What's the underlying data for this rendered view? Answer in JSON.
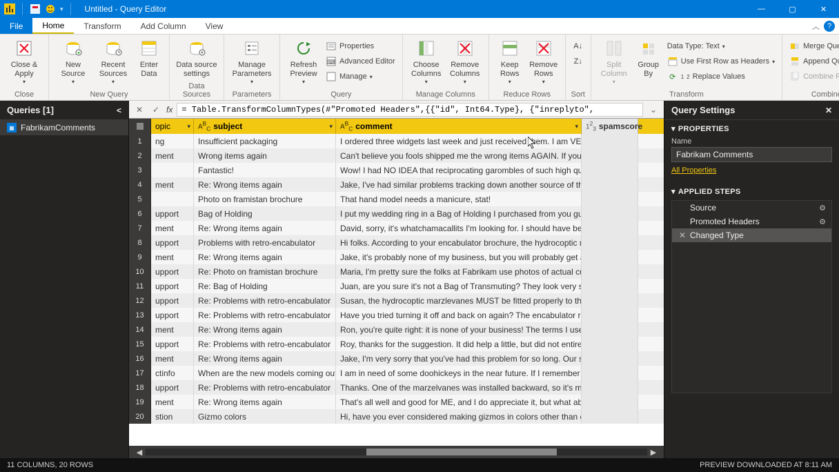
{
  "window": {
    "title": "Untitled - Query Editor"
  },
  "tabs": {
    "file": "File",
    "home": "Home",
    "transform": "Transform",
    "add_column": "Add Column",
    "view": "View"
  },
  "ribbon": {
    "close_apply": "Close &\nApply",
    "close_group": "Close",
    "new_source": "New\nSource",
    "recent_sources": "Recent\nSources",
    "enter_data": "Enter\nData",
    "new_query_group": "New Query",
    "data_source_settings": "Data source\nsettings",
    "data_sources_group": "Data Sources",
    "manage_parameters": "Manage\nParameters",
    "parameters_group": "Parameters",
    "refresh_preview": "Refresh\nPreview",
    "properties": "Properties",
    "advanced_editor": "Advanced Editor",
    "manage": "Manage",
    "query_group": "Query",
    "choose_columns": "Choose\nColumns",
    "remove_columns": "Remove\nColumns",
    "manage_columns_group": "Manage Columns",
    "keep_rows": "Keep\nRows",
    "remove_rows": "Remove\nRows",
    "reduce_rows_group": "Reduce Rows",
    "sort_group": "Sort",
    "split_column": "Split\nColumn",
    "group_by": "Group\nBy",
    "data_type": "Data Type: Text",
    "first_row_headers": "Use First Row as Headers",
    "replace_values": "Replace Values",
    "transform_group": "Transform",
    "merge_queries": "Merge Queries",
    "append_queries": "Append Queries",
    "combine_files": "Combine Files",
    "combine_group": "Combine"
  },
  "queries": {
    "header": "Queries [1]",
    "items": [
      {
        "name": "FabrikamComments"
      }
    ]
  },
  "formula": "= Table.TransformColumnTypes(#\"Promoted Headers\",{{\"id\", Int64.Type}, {\"inreplyto\",",
  "columns": {
    "topic": "opic",
    "subject": "subject",
    "comment": "comment",
    "spamscore": "spamscore"
  },
  "rows": [
    {
      "n": 1,
      "topic": "ng",
      "subject": "Insufficient packaging",
      "comment": "I ordered three widgets last week and just received them. I am VERY di..."
    },
    {
      "n": 2,
      "topic": "ment",
      "subject": "Wrong items again",
      "comment": "Can't believe you fools shipped me the wrong items AGAIN. If you wer..."
    },
    {
      "n": 3,
      "topic": "",
      "subject": "Fantastic!",
      "comment": "Wow! I had NO IDEA that reciprocating garombles of such high quality ..."
    },
    {
      "n": 4,
      "topic": "ment",
      "subject": "Re: Wrong items again",
      "comment": "Jake, I've had similar problems tracking down another source of thinga..."
    },
    {
      "n": 5,
      "topic": "",
      "subject": "Photo on framistan brochure",
      "comment": "That hand model needs a manicure, stat!"
    },
    {
      "n": 6,
      "topic": "upport",
      "subject": "Bag of Holding",
      "comment": "I put my wedding ring in a Bag of Holding I purchased from you guys (f..."
    },
    {
      "n": 7,
      "topic": "ment",
      "subject": "Re: Wrong items again",
      "comment": "David, sorry, it's whatchamacallits I'm looking for. I should have been ..."
    },
    {
      "n": 8,
      "topic": "upport",
      "subject": "Problems with retro-encabulator",
      "comment": "Hi folks. According to your encabulator brochure, the hydrocoptic mar..."
    },
    {
      "n": 9,
      "topic": "ment",
      "subject": "Re: Wrong items again",
      "comment": "Jake, it's probably none of my business, but you will probably get a bet..."
    },
    {
      "n": 10,
      "topic": "upport",
      "subject": "Re: Photo on framistan brochure",
      "comment": "Maria, I'm pretty sure the folks at Fabrikam use photos of actual custo..."
    },
    {
      "n": 11,
      "topic": "upport",
      "subject": "Re: Bag of Holding",
      "comment": "Juan, are you sure it's not a Bag of Transmuting? They look very simila..."
    },
    {
      "n": 12,
      "topic": "upport",
      "subject": "Re: Problems with retro-encabulator",
      "comment": "Susan, the hydrocoptic marzlevanes MUST be fitted properly to the a..."
    },
    {
      "n": 13,
      "topic": "upport",
      "subject": "Re: Problems with retro-encabulator",
      "comment": "Have you tried turning it off and back on again? The encabulator runs ..."
    },
    {
      "n": 14,
      "topic": "ment",
      "subject": "Re: Wrong items again",
      "comment": "Ron, you're quite right: it is none of your business! The terms I used ar..."
    },
    {
      "n": 15,
      "topic": "upport",
      "subject": "Re: Problems with retro-encabulator",
      "comment": "Roy, thanks for the suggestion. It did help a little, but did not entirely e..."
    },
    {
      "n": 16,
      "topic": "ment",
      "subject": "Re: Wrong items again",
      "comment": "Jake, I'm very sorry that you've had this problem for so long. Our syste..."
    },
    {
      "n": 17,
      "topic": "ctinfo",
      "subject": "When are the new models coming out?",
      "comment": "I am in need of some doohickeys in the near future. If I remember corr..."
    },
    {
      "n": 18,
      "topic": "upport",
      "subject": "Re: Problems with retro-encabulator",
      "comment": "Thanks. One of the marzelvanes was installed backward, so it's my faul..."
    },
    {
      "n": 19,
      "topic": "ment",
      "subject": "Re: Wrong items again",
      "comment": "That's all well and good for ME, and I do appreciate it, but what about ..."
    },
    {
      "n": 20,
      "topic": "stion",
      "subject": "Gizmo colors",
      "comment": "Hi, have you ever considered making gizmos in colors other than chart..."
    }
  ],
  "settings": {
    "header": "Query Settings",
    "properties": "PROPERTIES",
    "name_label": "Name",
    "name_value": "Fabrikam Comments",
    "all_properties": "All Properties",
    "applied_steps": "APPLIED STEPS",
    "steps": [
      {
        "name": "Source",
        "gear": true
      },
      {
        "name": "Promoted Headers",
        "gear": true
      },
      {
        "name": "Changed Type",
        "gear": false,
        "selected": true
      }
    ]
  },
  "statusbar": {
    "left": "11 COLUMNS, 20 ROWS",
    "right": "PREVIEW DOWNLOADED AT 8:11 AM"
  }
}
